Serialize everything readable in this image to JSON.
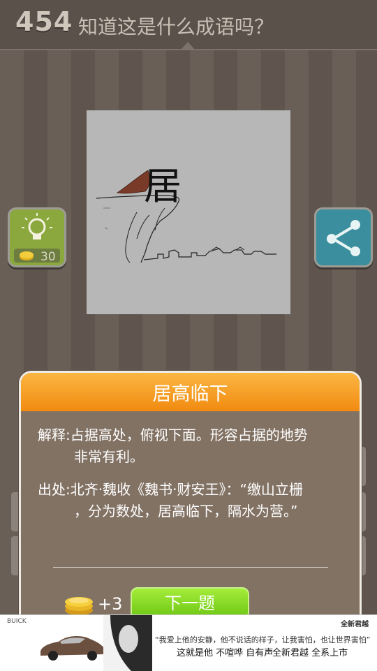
{
  "header": {
    "level": "454",
    "question": "知道这是什么成语吗？"
  },
  "puzzle": {
    "character": "居"
  },
  "hint": {
    "count": "30"
  },
  "dialog": {
    "answer": "居高临下",
    "definition_label": "解释:",
    "definition_line1": "占据高处，俯视下面。形容占据的地势",
    "definition_line2": "非常有利。",
    "source_label": "出处:",
    "source_line1": "北齐·魏收《魏书·财安王》：“缴山立栅",
    "source_line2": "，分为数处，居高临下，隔水为营。”",
    "reward": "+3",
    "next_label": "下一题"
  },
  "ad": {
    "brand": "BUICK",
    "logo": "全新君越",
    "quote": "“我爱上他的安静，他不说话的样子，让我害怕，也让世界害怕”",
    "line1": "这就是他  不喧哗  自有声",
    "line2": "全新君越  全系上市"
  },
  "colors": {
    "accent_orange": "#f39a1c",
    "next_green": "#7fd21f",
    "hint_green": "#8aa83e",
    "share_teal": "#3a8e9d"
  }
}
